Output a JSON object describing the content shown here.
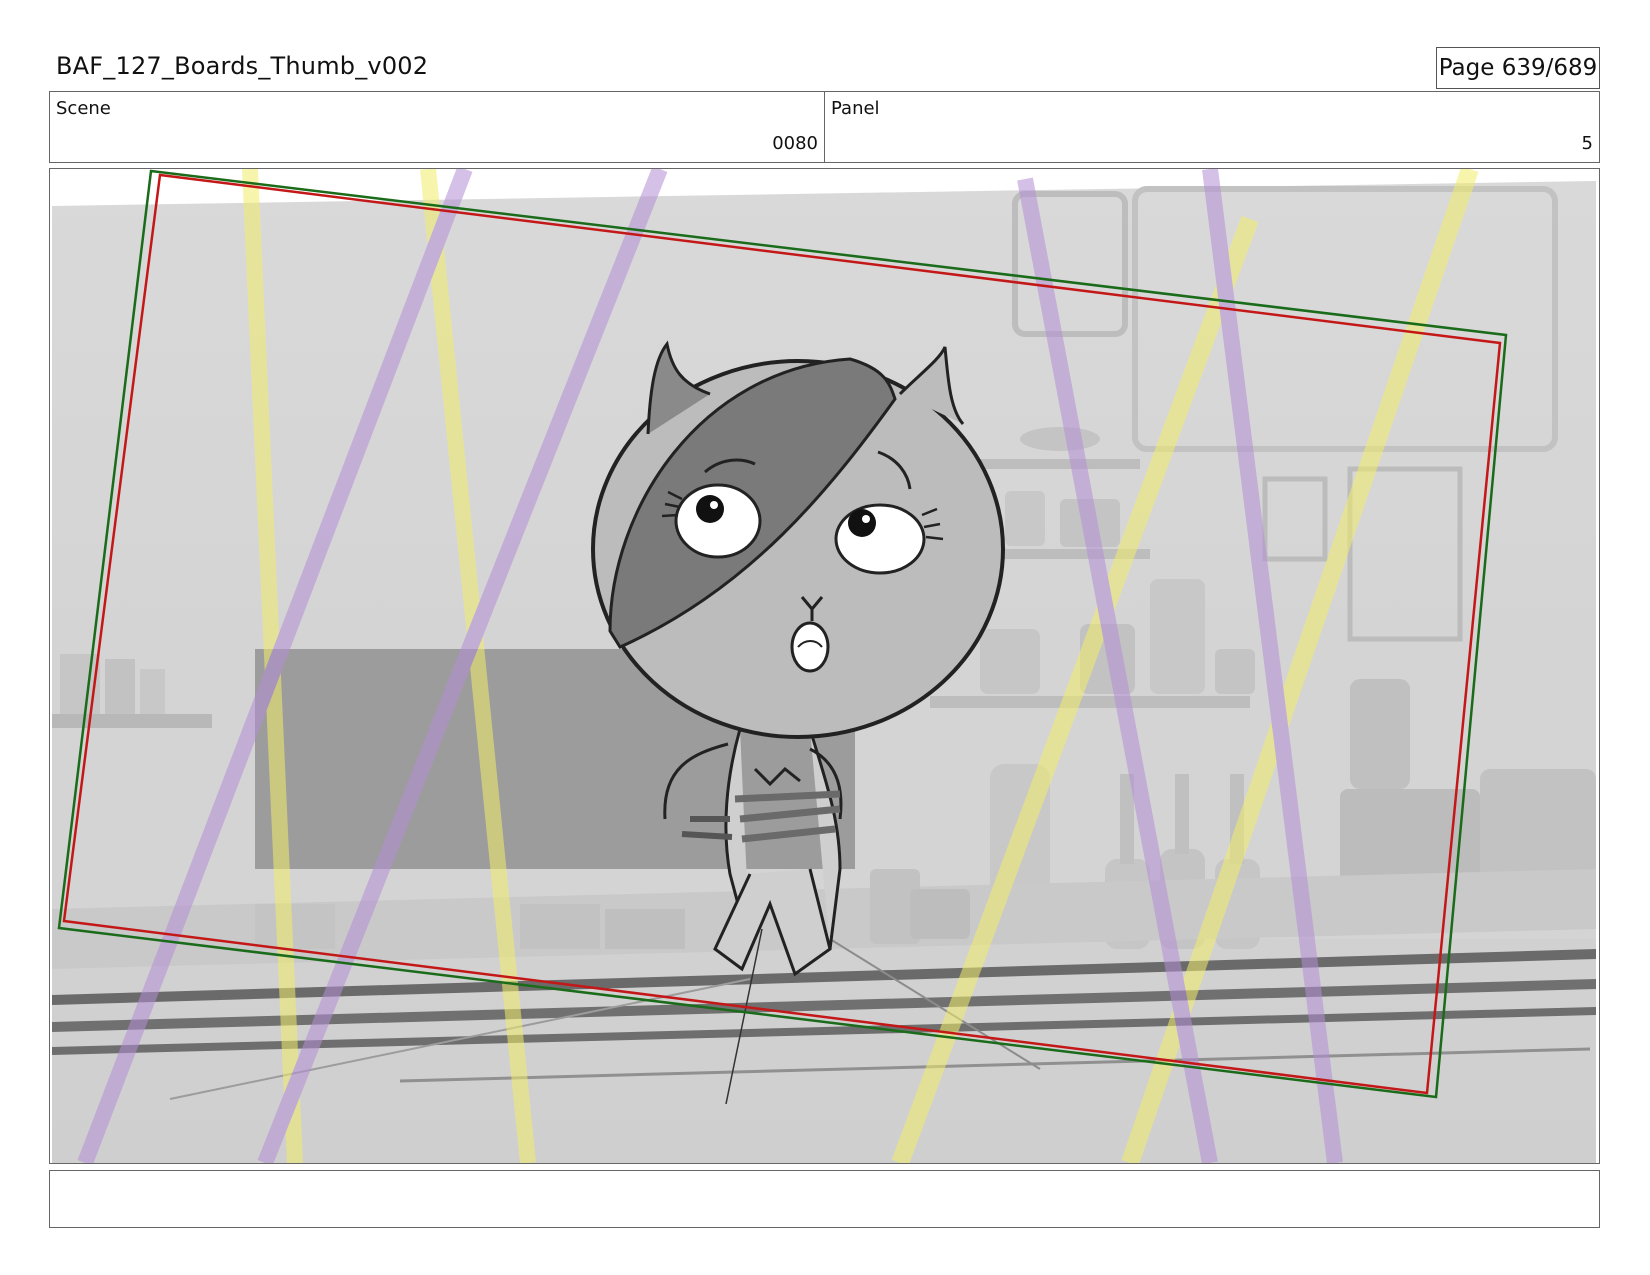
{
  "header": {
    "title": "BAF_127_Boards_Thumb_v002",
    "page": "Page 639/689"
  },
  "meta": {
    "scene_label": "Scene",
    "scene_value": "0080",
    "panel_label": "Panel",
    "panel_value": "5"
  },
  "frame": {
    "safe_area_outer_color": "#1a6b1a",
    "safe_area_inner_color": "#c41818",
    "highlight_colors": [
      "#f2ee6a",
      "#b48fd6"
    ],
    "icon": "cat-character-sketch"
  },
  "notes": {
    "text": ""
  }
}
